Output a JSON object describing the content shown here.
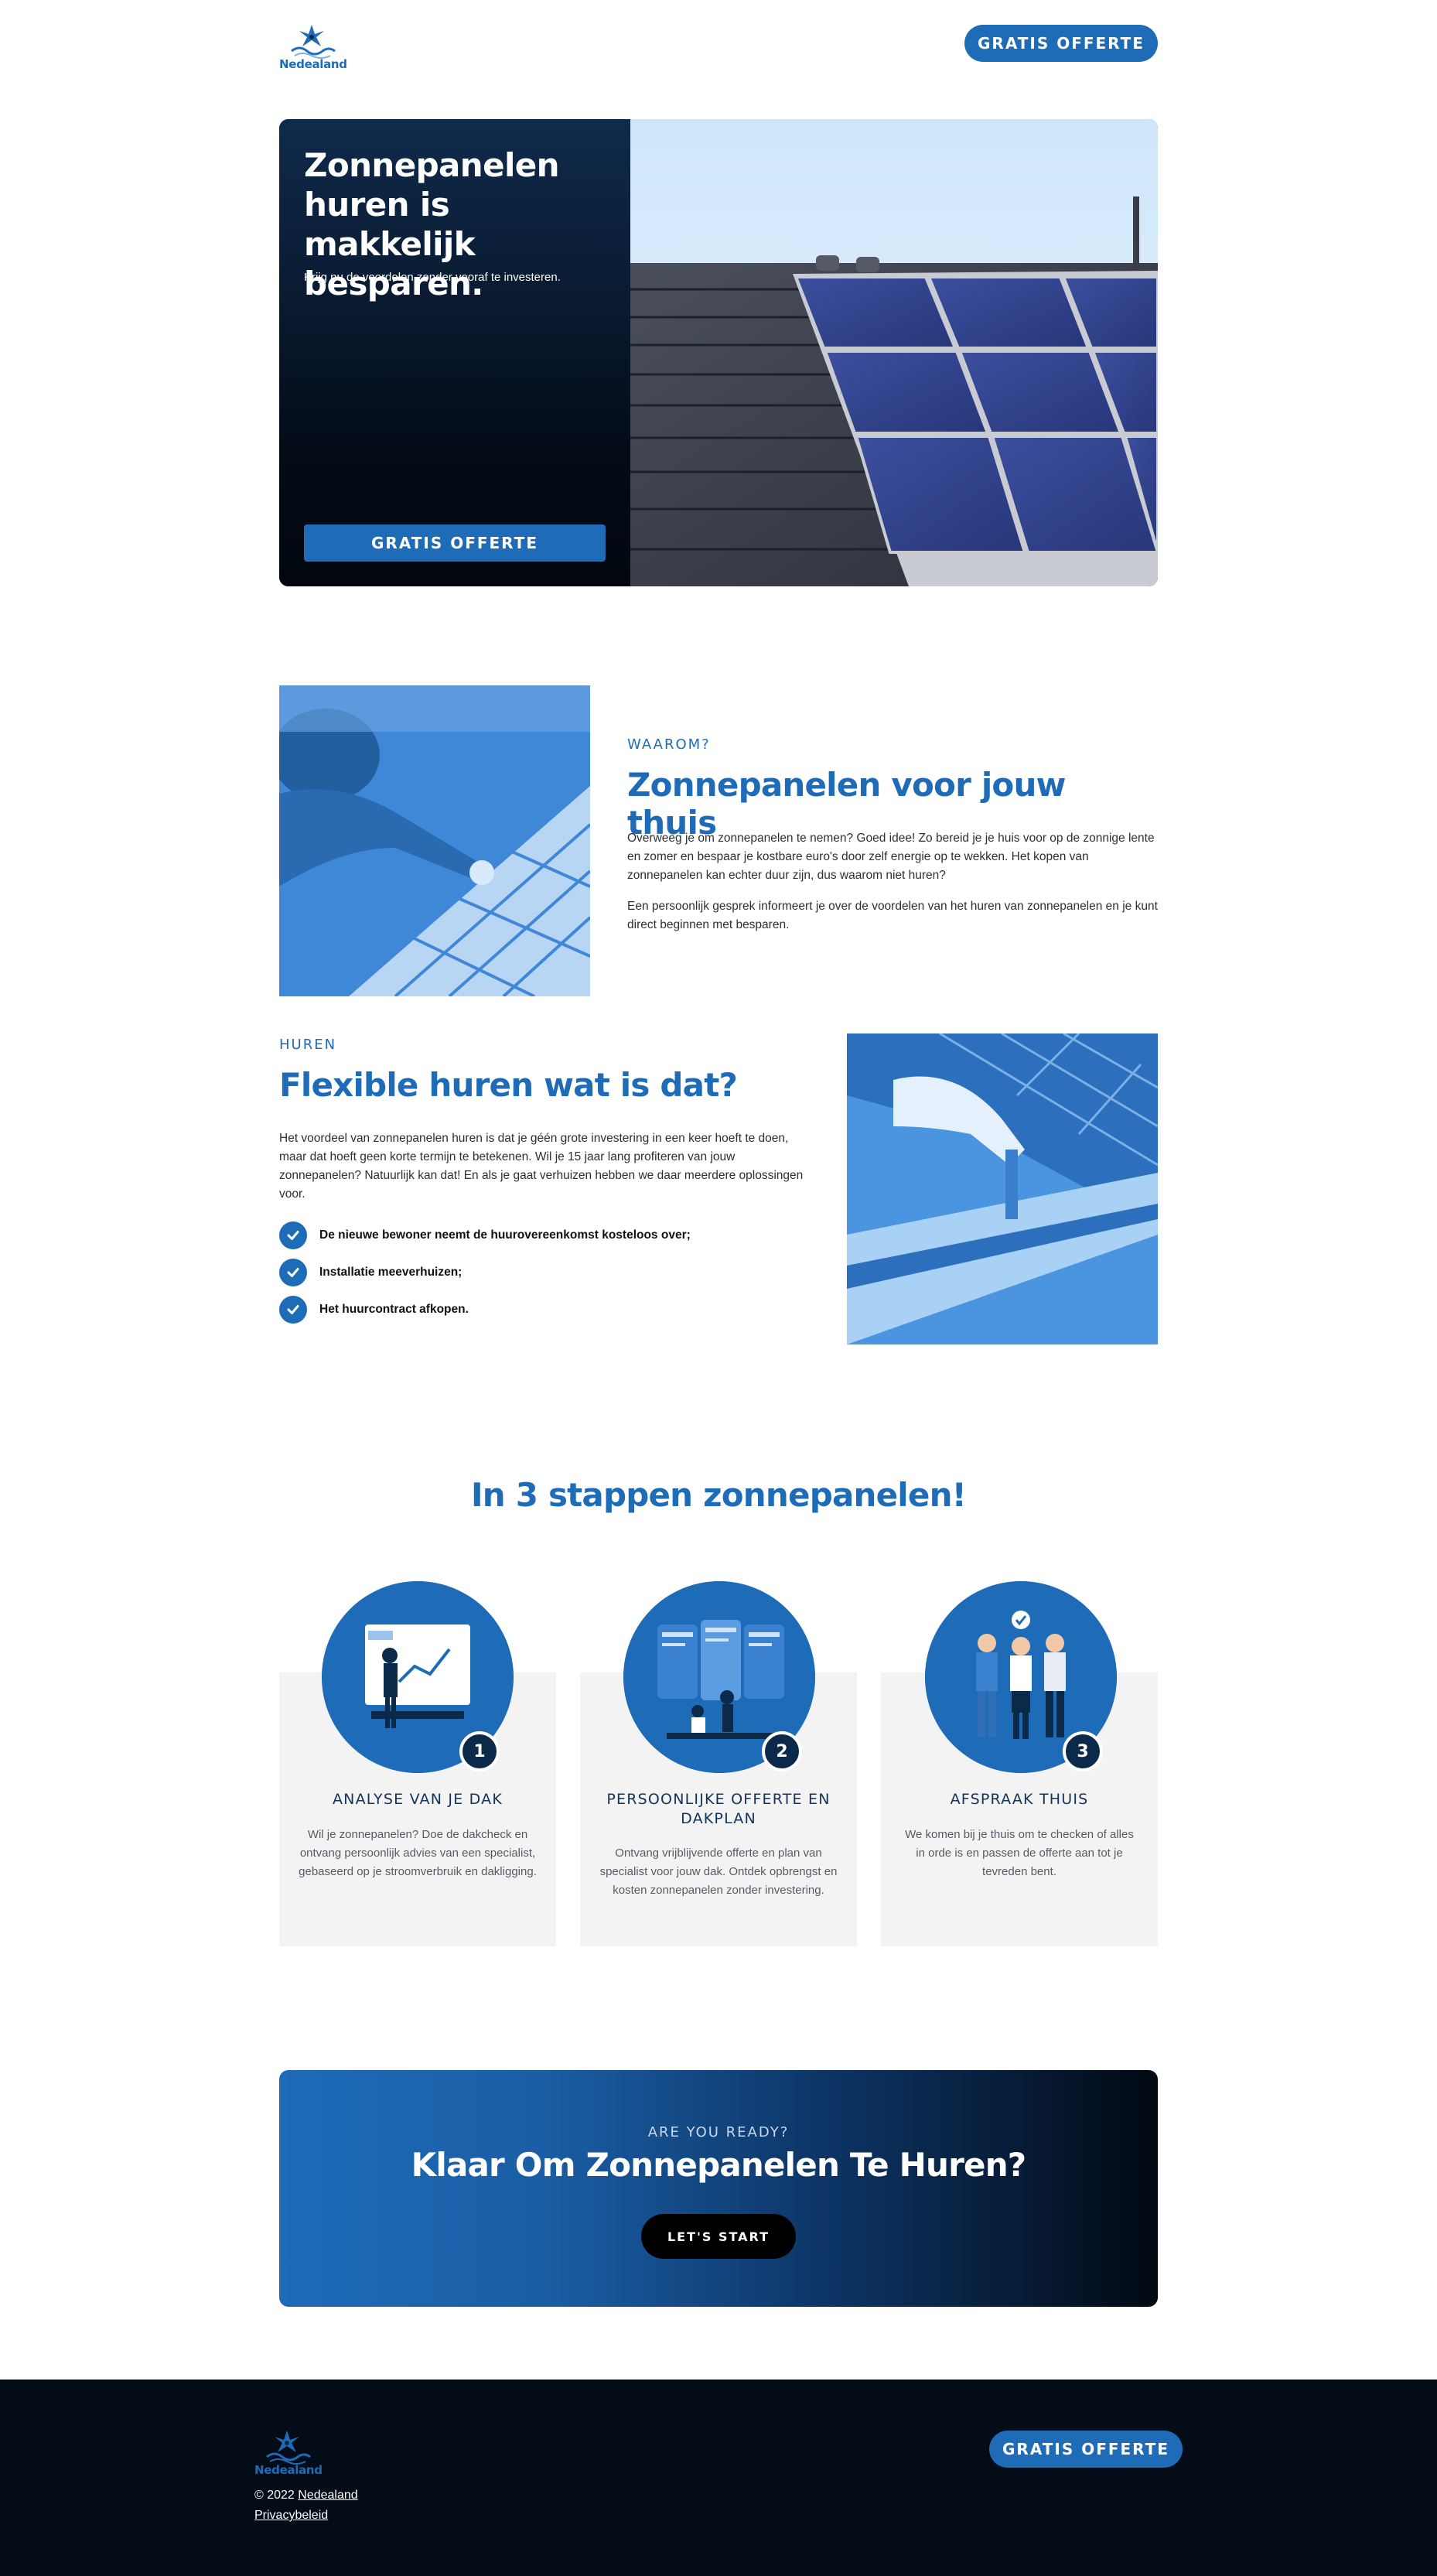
{
  "brand": {
    "name": "Nedealand",
    "accent": "#1e6bb8",
    "dark": "#040c18"
  },
  "header": {
    "cta_label": "GRATIS OFFERTE"
  },
  "hero": {
    "title": "Zonnepanelen huren is makkelijk besparen.",
    "subtitle": "Krijg nu de voordelen zonder vooraf te investeren.",
    "cta_label": "GRATIS OFFERTE"
  },
  "why": {
    "eyebrow": "WAAROM?",
    "title": "Zonnepanelen voor jouw thuis",
    "paragraph1": "Overweeg je om zonnepanelen te nemen? Goed idee! Zo bereid je je huis voor op de zonnige lente en zomer en bespaar je kostbare euro's door zelf energie op te wekken. Het kopen van zonnepanelen kan echter duur zijn, dus waarom niet huren?",
    "paragraph2": "Een persoonlijk gesprek informeert je over de voordelen van het huren van zonnepanelen en je kunt direct beginnen met besparen."
  },
  "rent": {
    "eyebrow": "HUREN",
    "title": "Flexible huren wat is dat?",
    "paragraph": "Het voordeel van zonnepanelen huren is dat je géén grote investering in een keer hoeft te doen, maar dat hoeft geen korte termijn te betekenen. Wil je 15 jaar lang profiteren van jouw zonnepanelen? Natuurlijk kan dat! En als je gaat verhuizen hebben we daar meerdere oplossingen voor.",
    "checklist": [
      "De nieuwe bewoner neemt de huurovereenkomst kosteloos over;",
      "Installatie meeverhuizen;",
      "Het huurcontract afkopen."
    ]
  },
  "steps": {
    "title": "In 3 stappen zonnepanelen!",
    "items": [
      {
        "number": "1",
        "title": "ANALYSE VAN JE DAK",
        "text": "Wil je zonnepanelen? Doe de dakcheck en ontvang persoonlijk advies van een specialist, gebaseerd op je stroomverbruik en dakligging."
      },
      {
        "number": "2",
        "title": "PERSOONLIJKE OFFERTE EN DAKPLAN",
        "text": "Ontvang vrijblijvende offerte en plan van specialist voor jouw dak. Ontdek opbrengst en kosten zonnepanelen zonder investering."
      },
      {
        "number": "3",
        "title": "AFSPRAAK THUIS",
        "text": "We komen bij je thuis om te checken of alles in orde is en passen de offerte aan tot je tevreden bent."
      }
    ]
  },
  "cta": {
    "eyebrow": "ARE YOU READY?",
    "title": "Klaar Om Zonnepanelen Te Huren?",
    "button_label": "LET'S START"
  },
  "footer": {
    "cta_label": "GRATIS OFFERTE",
    "copyright_prefix": "© 2022",
    "copyright_link": "Nedealand",
    "privacy_label": "Privacybeleid"
  }
}
